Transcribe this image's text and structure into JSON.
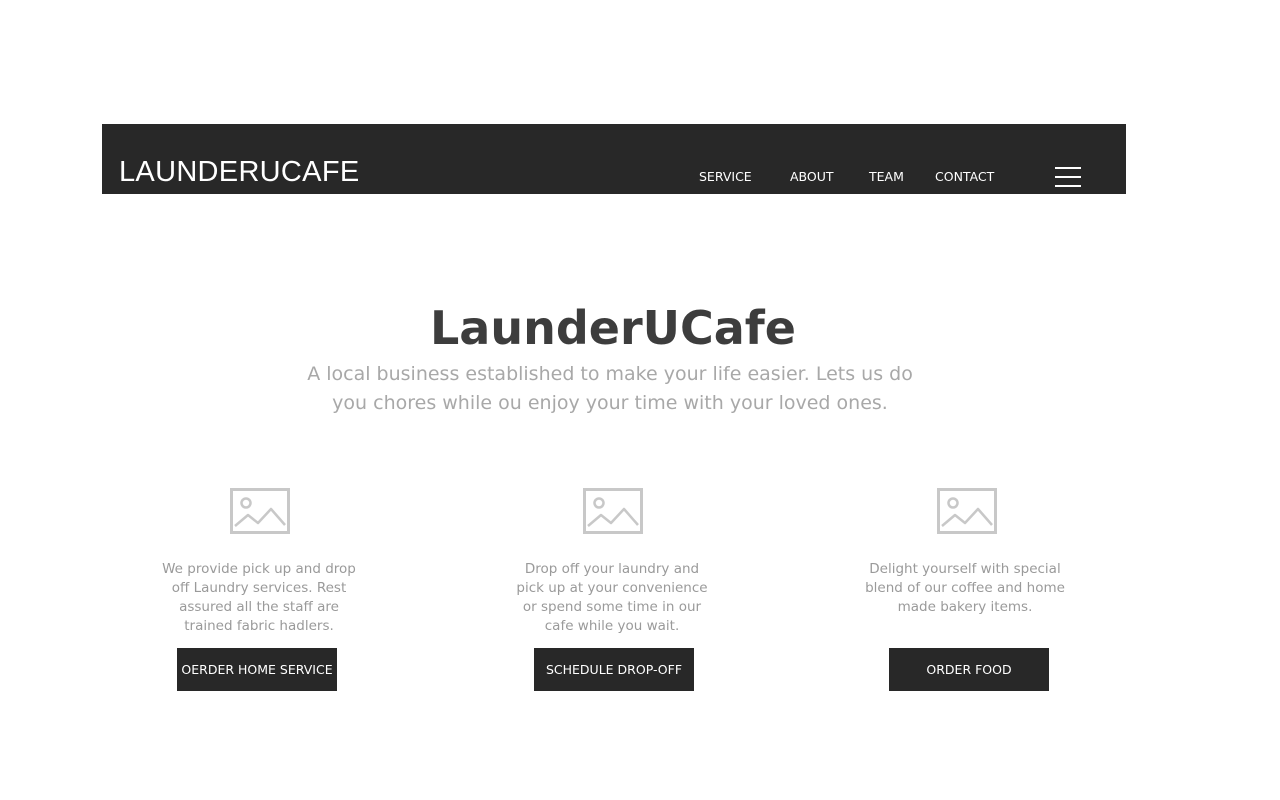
{
  "header": {
    "brand": "LAUNDERUCAFE",
    "nav": [
      {
        "label": "SERVICE"
      },
      {
        "label": "ABOUT"
      },
      {
        "label": "TEAM"
      },
      {
        "label": "CONTACT"
      }
    ],
    "menu_icon": "hamburger-menu-icon"
  },
  "hero": {
    "title": "LaunderUCafe",
    "subtitle": "A local business established to make your life easier. Lets us do you chores while ou enjoy your time with your loved ones."
  },
  "features": [
    {
      "icon": "image-placeholder-icon",
      "text": "We provide pick up and drop off Laundry services. Rest assured all the staff are trained fabric hadlers.",
      "button": "OERDER HOME SERVICE"
    },
    {
      "icon": "image-placeholder-icon",
      "text": "Drop off your laundry and pick up at your convenience or spend some time in our cafe while you wait.",
      "button": "SCHEDULE DROP-OFF"
    },
    {
      "icon": "image-placeholder-icon",
      "text": "Delight yourself with special blend of our coffee and home made bakery items.",
      "button": "ORDER FOOD"
    }
  ],
  "colors": {
    "navbar_bg": "#282828",
    "button_bg": "#282828",
    "title_text": "#3d3d3d",
    "muted_text": "#a8a8a8",
    "placeholder_icon": "#c8c8c8"
  }
}
